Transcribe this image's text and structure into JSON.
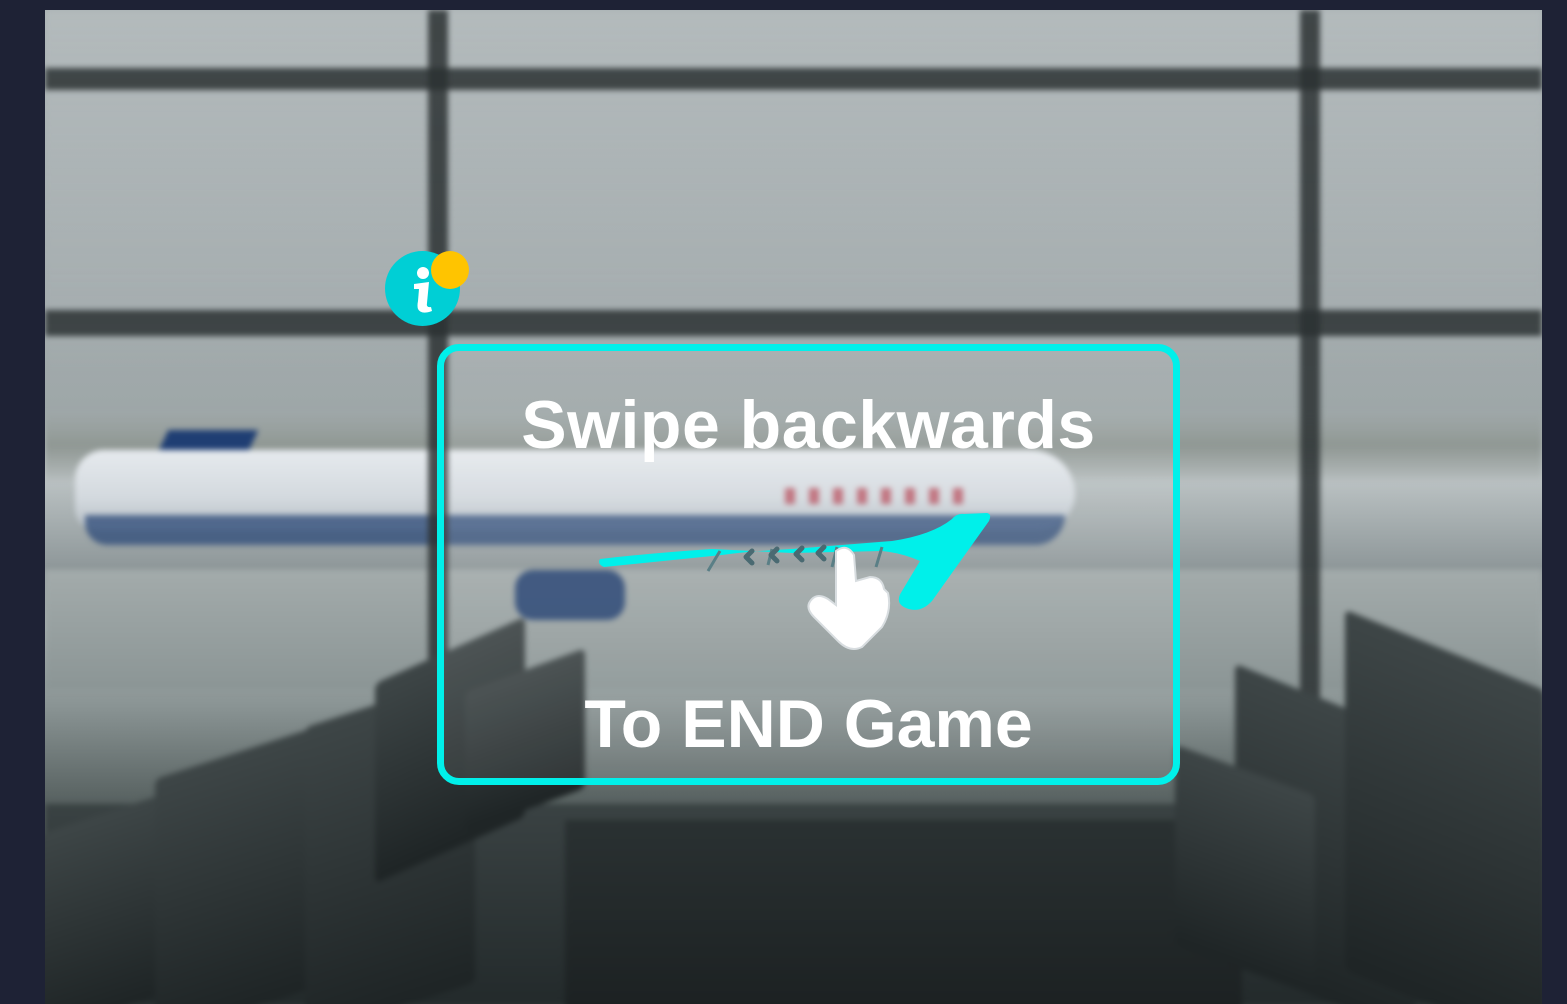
{
  "instruction": {
    "title": "Swipe backwards",
    "subtitle": "To END Game"
  },
  "icons": {
    "info": "info-icon",
    "notification": "notification-dot",
    "gesture": "swipe-backwards-gesture-icon",
    "hand": "pointing-hand-icon"
  },
  "colors": {
    "background": "#1e2235",
    "accent": "#00f0ea",
    "info_badge": "#00cfd5",
    "notification": "#ffc400",
    "text": "#ffffff"
  }
}
